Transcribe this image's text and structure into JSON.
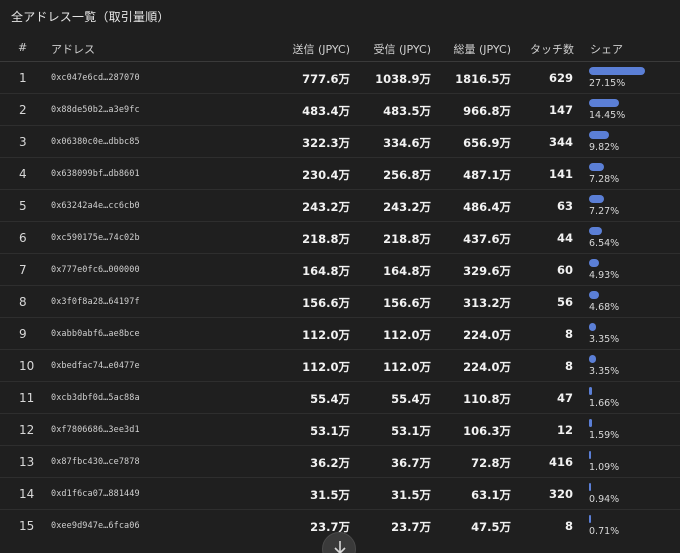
{
  "title": "全アドレス一覧（取引量順）",
  "headers": {
    "num": "#",
    "address": "アドレス",
    "sent": "送信 (JPYC)",
    "received": "受信 (JPYC)",
    "total": "総量 (JPYC)",
    "touch": "タッチ数",
    "share": "シェア"
  },
  "colors": {
    "bar": "#5b7fd6",
    "background": "#1f1f1f"
  },
  "rows": [
    {
      "num": "1",
      "address": "0xc047e6cd…287070",
      "sent": "777.6万",
      "received": "1038.9万",
      "total": "1816.5万",
      "touch": "629",
      "share": "27.15%",
      "share_value": 27.15
    },
    {
      "num": "2",
      "address": "0x88de50b2…a3e9fc",
      "sent": "483.4万",
      "received": "483.5万",
      "total": "966.8万",
      "touch": "147",
      "share": "14.45%",
      "share_value": 14.45
    },
    {
      "num": "3",
      "address": "0x06380c0e…dbbc85",
      "sent": "322.3万",
      "received": "334.6万",
      "total": "656.9万",
      "touch": "344",
      "share": "9.82%",
      "share_value": 9.82
    },
    {
      "num": "4",
      "address": "0x638099bf…db8601",
      "sent": "230.4万",
      "received": "256.8万",
      "total": "487.1万",
      "touch": "141",
      "share": "7.28%",
      "share_value": 7.28
    },
    {
      "num": "5",
      "address": "0x63242a4e…cc6cb0",
      "sent": "243.2万",
      "received": "243.2万",
      "total": "486.4万",
      "touch": "63",
      "share": "7.27%",
      "share_value": 7.27
    },
    {
      "num": "6",
      "address": "0xc590175e…74c02b",
      "sent": "218.8万",
      "received": "218.8万",
      "total": "437.6万",
      "touch": "44",
      "share": "6.54%",
      "share_value": 6.54
    },
    {
      "num": "7",
      "address": "0x777e0fc6…000000",
      "sent": "164.8万",
      "received": "164.8万",
      "total": "329.6万",
      "touch": "60",
      "share": "4.93%",
      "share_value": 4.93
    },
    {
      "num": "8",
      "address": "0x3f0f8a28…64197f",
      "sent": "156.6万",
      "received": "156.6万",
      "total": "313.2万",
      "touch": "56",
      "share": "4.68%",
      "share_value": 4.68
    },
    {
      "num": "9",
      "address": "0xabb0abf6…ae8bce",
      "sent": "112.0万",
      "received": "112.0万",
      "total": "224.0万",
      "touch": "8",
      "share": "3.35%",
      "share_value": 3.35
    },
    {
      "num": "10",
      "address": "0xbedfac74…e0477e",
      "sent": "112.0万",
      "received": "112.0万",
      "total": "224.0万",
      "touch": "8",
      "share": "3.35%",
      "share_value": 3.35
    },
    {
      "num": "11",
      "address": "0xcb3dbf0d…5ac88a",
      "sent": "55.4万",
      "received": "55.4万",
      "total": "110.8万",
      "touch": "47",
      "share": "1.66%",
      "share_value": 1.66
    },
    {
      "num": "12",
      "address": "0xf7806686…3ee3d1",
      "sent": "53.1万",
      "received": "53.1万",
      "total": "106.3万",
      "touch": "12",
      "share": "1.59%",
      "share_value": 1.59
    },
    {
      "num": "13",
      "address": "0x87fbc430…ce7878",
      "sent": "36.2万",
      "received": "36.7万",
      "total": "72.8万",
      "touch": "416",
      "share": "1.09%",
      "share_value": 1.09
    },
    {
      "num": "14",
      "address": "0xd1f6ca07…881449",
      "sent": "31.5万",
      "received": "31.5万",
      "total": "63.1万",
      "touch": "320",
      "share": "0.94%",
      "share_value": 0.94
    },
    {
      "num": "15",
      "address": "0xee9d947e…6fca06",
      "sent": "23.7万",
      "received": "23.7万",
      "total": "47.5万",
      "touch": "8",
      "share": "0.71%",
      "share_value": 0.71
    }
  ],
  "scroll_icon": "arrow-down-icon"
}
